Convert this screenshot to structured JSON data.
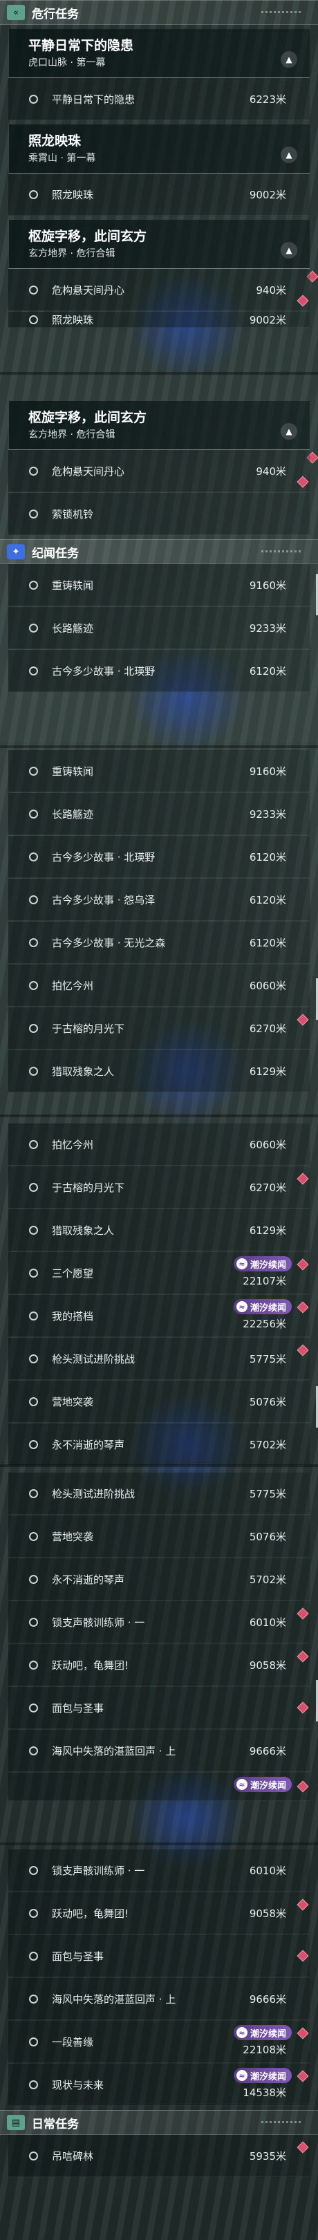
{
  "sections": {
    "danger": "危行任务",
    "chronicle": "纪闻任务",
    "daily": "日常任务"
  },
  "quests": {
    "pingjing": {
      "title": "平静日常下的隐患",
      "sub": "虎口山脉 · 第一幕"
    },
    "zhaolong": {
      "title": "照龙映珠",
      "sub": "乘霄山 · 第一幕"
    },
    "shuxuan": {
      "title": "枢旋字移，此间玄方",
      "sub": "玄方地界 · 危行合辑"
    }
  },
  "items": {
    "pingjing": {
      "name": "平静日常下的隐患",
      "dist": "6223米"
    },
    "zhaolong": {
      "name": "照龙映珠",
      "dist": "9002米"
    },
    "weigou": {
      "name": "危构悬天间丹心",
      "dist": "940米"
    },
    "suosuo": {
      "name": "萦锁机铃"
    },
    "zhongding": {
      "name": "重铸轶闻",
      "dist": "9160米"
    },
    "changlu": {
      "name": "长路觞迹",
      "dist": "9233米"
    },
    "beiying": {
      "name": "古今多少故事 · 北瑛野",
      "dist": "6120米"
    },
    "yuanyuze": {
      "name": "古今多少故事 · 怨乌泽",
      "dist": "6120米"
    },
    "wuguang": {
      "name": "古今多少故事 · 无光之森",
      "dist": "6120米"
    },
    "paiyi": {
      "name": "拍忆今州",
      "dist": "6060米"
    },
    "guju": {
      "name": "于古榕的月光下",
      "dist": "6270米"
    },
    "lieqi": {
      "name": "猎取残象之人",
      "dist": "6129米"
    },
    "sange": {
      "name": "三个愿望",
      "dist": "22107米"
    },
    "dada": {
      "name": "我的搭档",
      "dist": "22256米"
    },
    "qiangtou": {
      "name": "枪头测试进阶挑战",
      "dist": "5775米"
    },
    "yingdi": {
      "name": "营地突袭",
      "dist": "5076米"
    },
    "qinsheng": {
      "name": "永不消逝的琴声",
      "dist": "5702米"
    },
    "suolan": {
      "name": "锁支声骸训练师 · 一",
      "dist": "6010米"
    },
    "yueqi": {
      "name": "跃动吧，龟舞团!",
      "dist": "9058米"
    },
    "mianbao": {
      "name": "面包与圣事",
      "dist": ""
    },
    "haiwang": {
      "name": "海风中失落的湛蓝回声 · 上",
      "dist": "9666米"
    },
    "yiduan": {
      "name": "一段善缘",
      "dist": "22108米"
    },
    "xianshi": {
      "name": "现状与未来",
      "dist": "14538米"
    },
    "diaoling": {
      "name": "吊唁碑林",
      "dist": "5935米"
    }
  },
  "tag_label": "潮汐续闻",
  "icons": {
    "danger": "double-chevron-icon",
    "chronicle": "sparkle-icon",
    "daily": "calendar-icon",
    "collapse": "chevron-up-icon",
    "tide": "wave-icon",
    "marker": "diamond-marker-icon"
  },
  "colors": {
    "accent_green": "#5ea28a",
    "accent_blue": "#3d6fe0",
    "tag_purple": "#7452a8",
    "marker_red": "#d8506a"
  }
}
